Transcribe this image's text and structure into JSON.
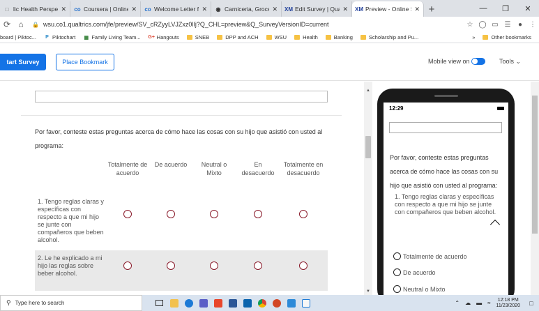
{
  "browser": {
    "tabs": [
      {
        "label": "lic Health Perspecti",
        "icon": "document-icon",
        "color": "#777777",
        "active": false
      },
      {
        "label": "Coursera | Online Cour",
        "icon": "coursera-icon",
        "color": "#2a73cc",
        "active": false
      },
      {
        "label": "Welcome Letter from Pr",
        "icon": "coursera-icon",
        "color": "#2a73cc",
        "active": false
      },
      {
        "label": "Carniceria, Grocery Stor",
        "icon": "globe-icon",
        "color": "#333333",
        "active": false
      },
      {
        "label": "Edit Survey | Qualtrics S",
        "icon": "qualtrics-icon",
        "color": "#21409a",
        "active": false
      },
      {
        "label": "Preview - Online Surve",
        "icon": "qualtrics-icon",
        "color": "#21409a",
        "active": true
      }
    ],
    "new_tab_label": "+",
    "url": "wsu.co1.qualtrics.com/jfe/preview/SV_cRZyyLVJZxz0lIj?Q_CHL=preview&Q_SurveyVersionID=current",
    "bookmarks": [
      {
        "label": "board | Piktoc...",
        "type": "link",
        "icon": ""
      },
      {
        "label": "Piktochart",
        "type": "link",
        "icon": "piktochart-icon"
      },
      {
        "label": "Family Living Team...",
        "type": "link",
        "icon": "grid-icon"
      },
      {
        "label": "Hangouts",
        "type": "link",
        "icon": "google-plus-icon"
      },
      {
        "label": "SNEB",
        "type": "folder",
        "icon": "folder-icon"
      },
      {
        "label": "DPP and ACH",
        "type": "folder",
        "icon": "folder-icon"
      },
      {
        "label": "WSU",
        "type": "folder",
        "icon": "folder-icon"
      },
      {
        "label": "Health",
        "type": "folder",
        "icon": "folder-icon"
      },
      {
        "label": "Banking",
        "type": "folder",
        "icon": "folder-icon"
      },
      {
        "label": "Scholarship and Pu...",
        "type": "folder",
        "icon": "folder-icon"
      }
    ],
    "bookmarks_more": "»",
    "other_bookmarks": "Other bookmarks"
  },
  "toolbar": {
    "start_survey": "tart Survey",
    "place_bookmark": "Place Bookmark",
    "mobile_view": "Mobile view on",
    "tools": "Tools",
    "accent": "#1473e6"
  },
  "survey": {
    "intro": "Por favor, conteste estas preguntas acerca de cómo hace las cosas con su hijo que asistió con usted al programa:",
    "columns": [
      "Totalmente de acuerdo",
      "De acuerdo",
      "Neutral o Mixto",
      "En desacuerdo",
      "Totalmente en desacuerdo"
    ],
    "rows": [
      {
        "label": "1. Tengo reglas claras y específicas con respecto a que mi hijo se junte con compañeros que beben alcohol."
      },
      {
        "label": "2. Le he explicado a mi hijo las reglas sobre beber alcohol."
      }
    ],
    "radio_color": "#8a1b2b"
  },
  "mobile": {
    "time": "12:29",
    "intro": "Por favor, conteste estas preguntas acerca de cómo hace las cosas con su hijo que asistió con usted al programa:",
    "question": "1. Tengo reglas claras y específicas con respecto a que mi hijo se junte con compañeros que beben alcohol.",
    "options": [
      "Totalmente de acuerdo",
      "De acuerdo",
      "Neutral o Mixto"
    ]
  },
  "taskbar": {
    "search_placeholder": "Type here to search",
    "time": "12:18 PM",
    "date": "11/23/2020"
  }
}
